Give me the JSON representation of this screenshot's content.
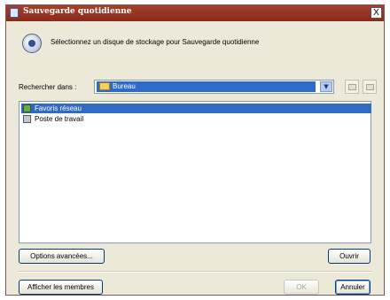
{
  "window": {
    "title": "Sauvegarde quotidienne",
    "close_glyph": "X"
  },
  "header": {
    "icon": "backup-disk-icon",
    "instruction": "Sélectionnez un disque de stockage pour Sauvegarde quotidienne"
  },
  "search": {
    "label": "Rechercher dans :",
    "selected": "Bureau",
    "folder_icon": "desktop-folder-icon",
    "arrow_glyph": "▼"
  },
  "toolbar": {
    "up_icon": "folder-up-icon",
    "new_folder_icon": "new-folder-icon"
  },
  "list": {
    "items": [
      {
        "label": "Favoris réseau",
        "icon": "network-places-icon",
        "selected": true
      },
      {
        "label": "Poste de travail",
        "icon": "my-computer-icon",
        "selected": false
      }
    ]
  },
  "buttons": {
    "advanced": "Options avancées...",
    "open": "Ouvrir",
    "show_members": "Afficher les membres",
    "ok": "OK",
    "cancel": "Annuler"
  },
  "colors": {
    "title_bar": "#9a3522",
    "selection": "#316ac5",
    "dialog_bg": "#ece9d8"
  }
}
